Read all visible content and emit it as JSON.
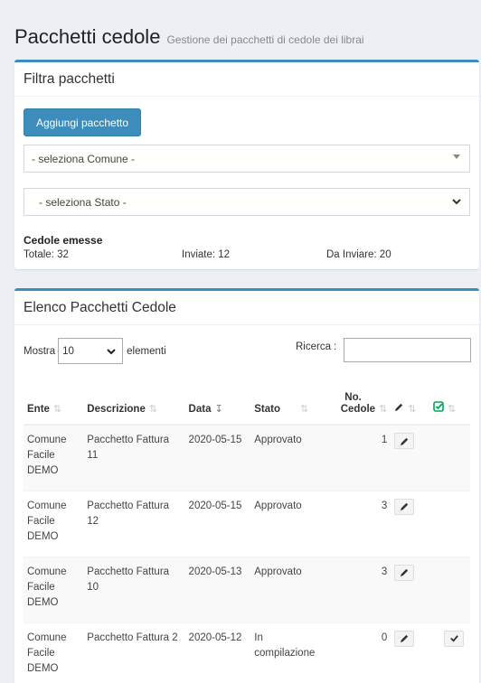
{
  "header": {
    "title": "Pacchetti cedole",
    "subtitle": "Gestione dei pacchetti di cedole dei librai"
  },
  "filter_box": {
    "title": "Filtra pacchetti",
    "add_button": "Aggiungi pacchetto",
    "comune_select": "- seleziona Comune -",
    "stato_select": "- seleziona Stato -",
    "cedole_title": "Cedole emesse",
    "totale": "Totale: 32",
    "inviate": "Inviate: 12",
    "da_inviare": "Da Inviare: 20"
  },
  "list_box": {
    "title": "Elenco Pacchetti Cedole",
    "length_prefix": "Mostra",
    "length_value": "10",
    "length_suffix": "elementi",
    "search_label": "Ricerca :",
    "search_value": "",
    "columns": {
      "ente": "Ente",
      "descrizione": "Descrizione",
      "data": "Data",
      "stato": "Stato",
      "cedole_line1": "No.",
      "cedole_line2": "Cedole"
    },
    "rows": [
      {
        "ente": "Comune Facile DEMO",
        "descrizione": "Pacchetto Fattura 11",
        "data": "2020-05-15",
        "stato": "Approvato",
        "cedole": "1"
      },
      {
        "ente": "Comune Facile DEMO",
        "descrizione": "Pacchetto Fattura 12",
        "data": "2020-05-15",
        "stato": "Approvato",
        "cedole": "3"
      },
      {
        "ente": "Comune Facile DEMO",
        "descrizione": "Pacchetto Fattura 10",
        "data": "2020-05-13",
        "stato": "Approvato",
        "cedole": "3"
      },
      {
        "ente": "Comune Facile DEMO",
        "descrizione": "Pacchetto Fattura 2",
        "data": "2020-05-12",
        "stato": "In compilazione",
        "cedole": "0"
      }
    ]
  },
  "colors": {
    "primary": "#3c8dbc",
    "approve_icon": "#00a65a"
  },
  "icons": {
    "edit": "pencil-icon",
    "approve": "check-square-icon",
    "check": "check-icon"
  }
}
